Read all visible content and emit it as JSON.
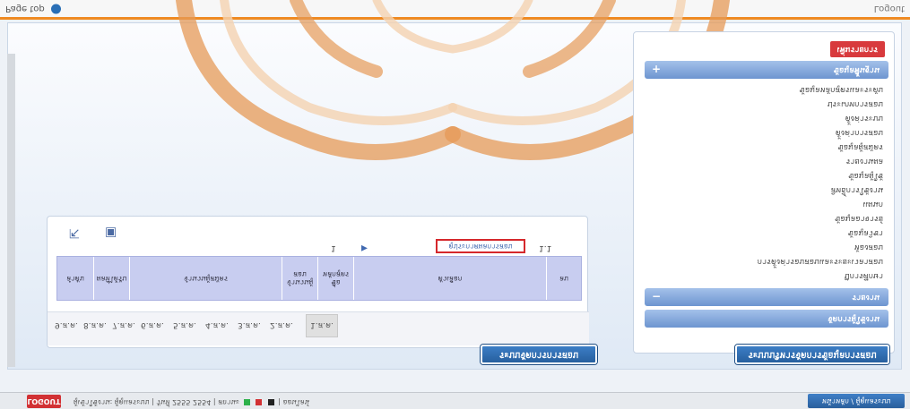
{
  "colors": {
    "accent": "#ef8a22",
    "brand_blue": "#2a6fb6",
    "danger": "#d83a3d",
    "header_purple": "#c8cdf0"
  },
  "topbar": {
    "left_text": "Page top",
    "right_text": "Logout"
  },
  "left_panel": {
    "toolbar": {
      "export_icon": "export-icon",
      "save_icon": "save-icon"
    },
    "row_text": "1.1",
    "link_text": "ดูประกาศผลการสอบ",
    "arrow_icon": "play-icon",
    "count_text": "1",
    "columns": [
      "ลำดับ",
      "ผลที่ได้รับ",
      "จำนวนผู้สมัคร",
      "จำนวนผู้สอบ",
      "ชื่อหลักสูตร",
      "ตัวเลือก",
      "ลบ"
    ],
    "pager": [
      "1.ส.ค.",
      "2.ส.ค.",
      "3.ส.ค.",
      "4.ส.ค.",
      "5.ส.ค.",
      "6.ส.ค.",
      "7.ส.ค.",
      "8.ส.ค.",
      "9.ส.ค."
    ],
    "active_page_index": 0,
    "button_label": "ระบบจัดการการสอบ"
  },
  "right_panel": {
    "new_button": "เพิ่มรายการ",
    "accordion_open": "ข้อมูลพื้นฐาน",
    "items": [
      "ข้อมูลหลักสูตรและระดับ",
      "ประเภทการสอบ",
      "ตั้งค่าระบบ",
      "ตั้งค่าการสอบ",
      "ข้อมูลผู้สมัคร",
      "รายงานผล",
      "ข้อมูลผู้ใช้",
      "สิทธิ์การใช้งาน",
      "แผนก",
      "ข้อมูลอาจารย์",
      "ข้อมูลวิชา",
      "ห้องสอบ",
      "การตั้งค่ารอบสอบและระยะเวลาสอบ",
      "ปีการศึกษา",
      "ภาคเรียน"
    ],
    "accordion_two": "รายงาน",
    "accordion_three": "จัดการผู้ใช้งาน",
    "button_label": "ระบบบริหารจัดการข้อมูลการสอบ"
  },
  "bottombar": {
    "logout_label": "LOGOUT",
    "status_text": "ผู้เข้าใช้งาน: ผู้ดูแลระบบ | วันที่ 2555 2554 | สถานะ",
    "status_suffix": "| ออนไลน์",
    "home_label": "หน้าหลัก / ผู้ดูแลระบบ"
  }
}
